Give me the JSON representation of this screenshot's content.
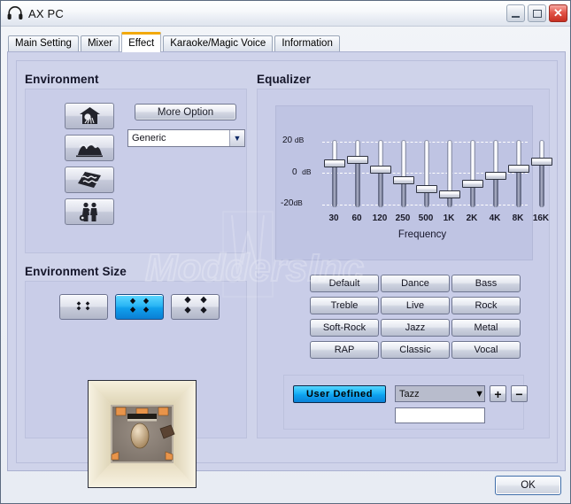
{
  "window": {
    "title": "AX PC",
    "icon": "headphones-icon",
    "controls": {
      "minimize": "minimize-icon",
      "maximize": "maximize-icon",
      "close": "close-icon"
    }
  },
  "tabs": [
    {
      "label": "Main Setting",
      "active": false
    },
    {
      "label": "Mixer",
      "active": false
    },
    {
      "label": "Effect",
      "active": true
    },
    {
      "label": "Karaoke/Magic Voice",
      "active": false
    },
    {
      "label": "Information",
      "active": false
    }
  ],
  "environment": {
    "title": "Environment",
    "icon_buttons": [
      {
        "name": "environment-room-icon",
        "label": "Room"
      },
      {
        "name": "environment-concert-hall-icon",
        "label": "Concert Hall"
      },
      {
        "name": "environment-carpet-icon",
        "label": "Carpet"
      },
      {
        "name": "environment-live-stage-icon",
        "label": "Live Stage"
      }
    ],
    "more_option_label": "More Option",
    "preset_select": {
      "value": "Generic",
      "options": [
        "Generic"
      ]
    }
  },
  "environment_size": {
    "title": "Environment Size",
    "buttons": [
      {
        "name": "size-small",
        "selected": false
      },
      {
        "name": "size-medium",
        "selected": true
      },
      {
        "name": "size-large",
        "selected": false
      }
    ],
    "preview_alt": "Top-down room preview with speakers and listener"
  },
  "equalizer": {
    "title": "Equalizer",
    "axis_title": "Frequency",
    "db_labels": [
      {
        "value": "20",
        "unit": "dB"
      },
      {
        "value": "0",
        "unit": "dB"
      },
      {
        "value": "-20",
        "unit": "dB"
      }
    ],
    "presets": [
      "Default",
      "Dance",
      "Bass",
      "Treble",
      "Live",
      "Rock",
      "Soft-Rock",
      "Jazz",
      "Metal",
      "RAP",
      "Classic",
      "Vocal"
    ],
    "user_defined": {
      "button_label": "User Defined",
      "select_value": "Tazz",
      "select_options": [
        "Tazz"
      ],
      "add_label": "+",
      "remove_label": "−",
      "name_input_value": "",
      "name_input_placeholder": ""
    }
  },
  "chart_data": {
    "type": "bar",
    "title": "Equalizer",
    "xlabel": "Frequency",
    "ylabel": "dB",
    "categories": [
      "30",
      "60",
      "120",
      "250",
      "500",
      "1K",
      "2K",
      "4K",
      "8K",
      "16K"
    ],
    "values": [
      7.5,
      9.5,
      4.0,
      -2.5,
      -8.0,
      -11.5,
      -5.0,
      -0.5,
      4.5,
      8.0
    ],
    "ylim": [
      -20,
      20
    ],
    "yticks": [
      20,
      0,
      -20
    ],
    "grid": true,
    "legend": "none"
  },
  "footer": {
    "ok_label": "OK"
  },
  "watermark": {
    "text": "ModdersInc"
  },
  "colors": {
    "panel": "#c9cde8",
    "client": "#cfd3ea",
    "eq_plot": "#bfc4e3",
    "accent_blue": "#11a0ec",
    "tab_active_top": "#f2a90b",
    "close_red": "#c72f22"
  }
}
